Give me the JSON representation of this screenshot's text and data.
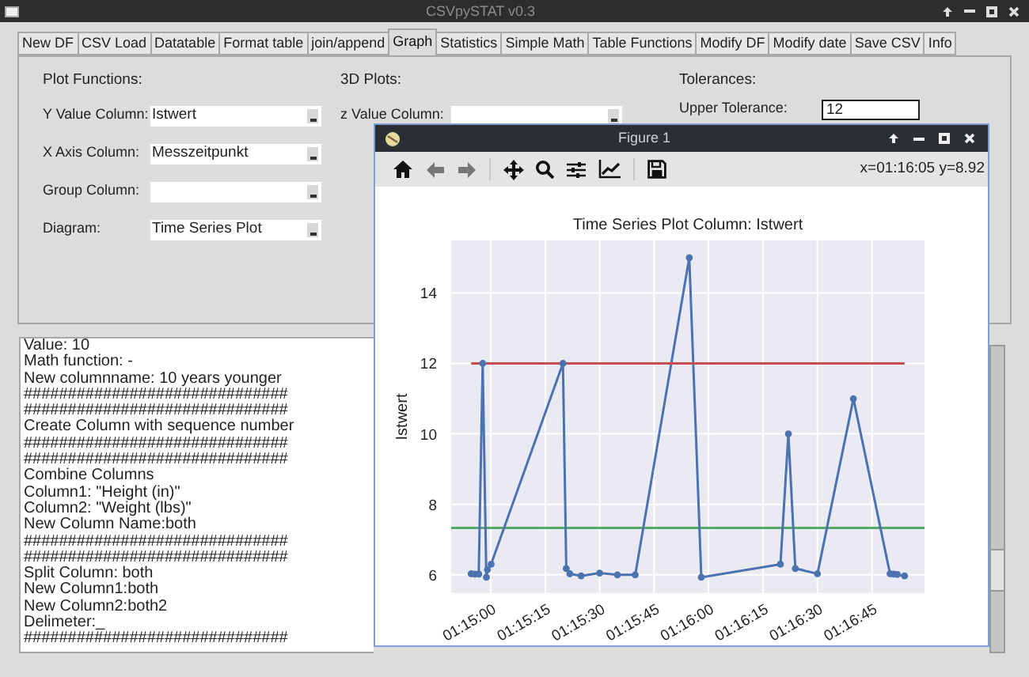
{
  "window": {
    "title": "CSVpySTAT v0.3"
  },
  "tabs": [
    {
      "label": "New DF",
      "selected": false
    },
    {
      "label": "CSV Load",
      "selected": false
    },
    {
      "label": "Datatable",
      "selected": false
    },
    {
      "label": "Format table",
      "selected": false
    },
    {
      "label": "join/append",
      "selected": false
    },
    {
      "label": "Graph",
      "selected": true
    },
    {
      "label": "Statistics",
      "selected": false
    },
    {
      "label": "Simple Math",
      "selected": false
    },
    {
      "label": "Table Functions",
      "selected": false
    },
    {
      "label": "Modify DF",
      "selected": false
    },
    {
      "label": "Modify date",
      "selected": false
    },
    {
      "label": "Save CSV",
      "selected": false
    },
    {
      "label": "Info",
      "selected": false
    }
  ],
  "sections": [
    {
      "heading": "Plot Functions:",
      "fields": [
        {
          "kind": "dropdown",
          "label": "Y Value Column:",
          "value": "Istwert"
        },
        {
          "kind": "dropdown",
          "label": "X Axis Column:",
          "value": "Messzeitpunkt"
        },
        {
          "kind": "dropdown",
          "label": "Group Column:"
        },
        {
          "kind": "dropdown",
          "label": "Diagram:",
          "value": "Time Series Plot"
        }
      ]
    },
    {
      "heading": "3D Plots:",
      "fields": [
        {
          "kind": "dropdown",
          "label": "z Value Column:"
        }
      ]
    },
    {
      "heading": "Tolerances:",
      "fields": [
        {
          "kind": "entry",
          "label": "Upper Tolerance:",
          "value": "12"
        }
      ]
    }
  ],
  "log": {
    "lines": [
      "Value: 10",
      "Math function: -",
      "New columnname: 10 years younger",
      "##############################",
      "##############################",
      "Create Column with sequence number",
      "##############################",
      "##############################",
      "Combine Columns",
      "Column1: \"Height (in)\"",
      "Column2: \"Weight (lbs)\"",
      "New Column Name:both",
      "##############################",
      "##############################",
      "Split Column: both",
      "New Column1:both",
      "New Column2:both2",
      "Delimeter:_",
      "##############################"
    ]
  },
  "figure": {
    "title": "Figure 1",
    "coordinates": "x=01:16:05 y=8.92",
    "chart_data": {
      "type": "line",
      "title": "Time Series Plot Column: Istwert",
      "ylabel": "Istwert",
      "x": [
        4494.6,
        4495.6,
        4496.7,
        4497.8,
        4498.8,
        4499.1,
        4500.1,
        4519.9,
        4520.8,
        4521.8,
        4524.9,
        4530.0,
        4534.9,
        4539.8,
        4554.7,
        4558.0,
        4579.8,
        4582.0,
        4583.9,
        4590.0,
        4599.9,
        4610.0,
        4611.0,
        4612.0,
        4614.0
      ],
      "grid": true,
      "series": [
        {
          "color": "#4c72b0",
          "marker": "o",
          "values": [
            6.03,
            6.02,
            6.02,
            12.0,
            5.93,
            6.15,
            6.3,
            12.0,
            6.18,
            6.03,
            5.97,
            6.05,
            6.0,
            6.0,
            15.0,
            5.93,
            6.3,
            10.0,
            6.18,
            6.03,
            11.0,
            6.03,
            6.02,
            6.01,
            5.97
          ]
        },
        {
          "color": "#c44e52",
          "values": [
            12,
            12,
            12,
            12,
            12,
            12,
            12,
            12,
            12,
            12,
            12,
            12,
            12,
            12,
            12,
            12,
            12,
            12,
            12,
            12,
            12,
            12,
            12,
            12,
            12
          ]
        }
      ],
      "xlim": [
        4489.1,
        4619.5
      ],
      "ylim": [
        5.48,
        15.49
      ],
      "xticks": [
        {
          "value": 4500,
          "label": "01:15:00"
        },
        {
          "value": 4515,
          "label": "01:15:15"
        },
        {
          "value": 4530,
          "label": "01:15:30"
        },
        {
          "value": 4545,
          "label": "01:15:45"
        },
        {
          "value": 4560,
          "label": "01:16:00"
        },
        {
          "value": 4575,
          "label": "01:16:15"
        },
        {
          "value": 4590,
          "label": "01:16:30"
        },
        {
          "value": 4605,
          "label": "01:16:45"
        }
      ],
      "yticks": [
        6,
        8,
        10,
        12,
        14
      ],
      "ref_lines": [
        {
          "axis": "y",
          "value": 7.33,
          "color": "#55a868"
        }
      ]
    }
  }
}
